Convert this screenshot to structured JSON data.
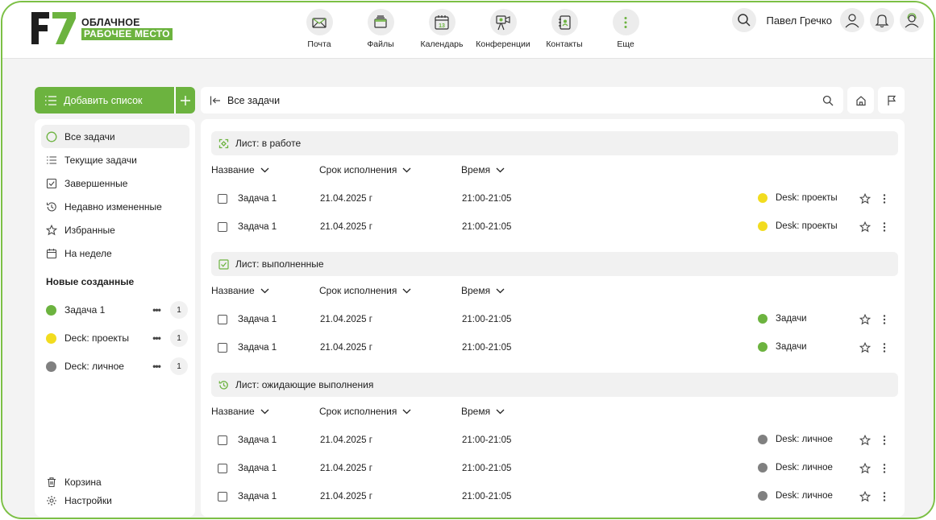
{
  "logo": {
    "mark": "F7",
    "line1": "ОБЛАЧНОЕ",
    "line2": "РАБОЧЕЕ МЕСТО"
  },
  "nav": [
    {
      "label": "Почта",
      "icon": "mail-icon"
    },
    {
      "label": "Файлы",
      "icon": "files-icon"
    },
    {
      "label": "Календарь",
      "icon": "calendar-icon",
      "badge": "13"
    },
    {
      "label": "Конференции",
      "icon": "conference-icon"
    },
    {
      "label": "Контакты",
      "icon": "contacts-icon"
    },
    {
      "label": "Еще",
      "icon": "more-icon"
    }
  ],
  "header": {
    "user_name": "Павел Гречко"
  },
  "sidebar": {
    "add_list_label": "Добавить список",
    "items": [
      {
        "label": "Все задачи",
        "icon": "circle-icon",
        "active": true
      },
      {
        "label": "Текущие задачи",
        "icon": "list-icon"
      },
      {
        "label": "Завершенные",
        "icon": "checkbox-icon"
      },
      {
        "label": "Недавно измененные",
        "icon": "history-icon"
      },
      {
        "label": "Избранные",
        "icon": "star-icon"
      },
      {
        "label": "На неделе",
        "icon": "calendar-icon"
      }
    ],
    "section_title": "Новые созданные",
    "lists": [
      {
        "label": "Задача 1",
        "color": "#6cb33f",
        "count": "1"
      },
      {
        "label": "Deck: проекты",
        "color": "#f2dc1f",
        "count": "1"
      },
      {
        "label": "Deck: личное",
        "color": "#808080",
        "count": "1"
      }
    ],
    "trash_label": "Корзина",
    "settings_label": "Настройки"
  },
  "topbar": {
    "title": "Все задачи"
  },
  "columns": {
    "name": "Название",
    "due": "Срок исполнения",
    "time": "Время"
  },
  "groups": [
    {
      "title": "Лист: в работе",
      "icon": "in-progress-icon",
      "rows": [
        {
          "name": "Задача 1",
          "date": "21.04.2025 г",
          "time": "21:00-21:05",
          "tag": "Desk: проекты",
          "color": "#f2dc1f"
        },
        {
          "name": "Задача 1",
          "date": "21.04.2025 г",
          "time": "21:00-21:05",
          "tag": "Desk: проекты",
          "color": "#f2dc1f"
        }
      ]
    },
    {
      "title": "Лист: выполненные",
      "icon": "checkbox-icon",
      "rows": [
        {
          "name": "Задача 1",
          "date": "21.04.2025 г",
          "time": "21:00-21:05",
          "tag": "Задачи",
          "color": "#6cb33f"
        },
        {
          "name": "Задача 1",
          "date": "21.04.2025 г",
          "time": "21:00-21:05",
          "tag": "Задачи",
          "color": "#6cb33f"
        }
      ]
    },
    {
      "title": "Лист: ожидающие выполнения",
      "icon": "history-icon",
      "rows": [
        {
          "name": "Задача 1",
          "date": "21.04.2025 г",
          "time": "21:00-21:05",
          "tag": "Desk: личное",
          "color": "#808080"
        },
        {
          "name": "Задача 1",
          "date": "21.04.2025 г",
          "time": "21:00-21:05",
          "tag": "Desk: личное",
          "color": "#808080"
        },
        {
          "name": "Задача 1",
          "date": "21.04.2025 г",
          "time": "21:00-21:05",
          "tag": "Desk: личное",
          "color": "#808080"
        }
      ]
    }
  ],
  "colors": {
    "accent": "#6cb33f",
    "border": "#7cc045"
  }
}
